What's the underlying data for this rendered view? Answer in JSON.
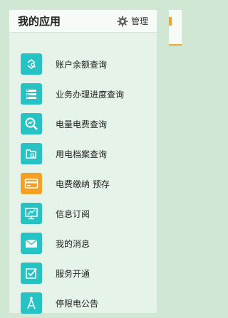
{
  "panel": {
    "title": "我的应用",
    "manage_label": "管理",
    "manage_icon": "gear-icon"
  },
  "menu": {
    "items": [
      {
        "label": "账户余额查询",
        "icon": "account-balance-icon",
        "color": "#27c2c4"
      },
      {
        "label": "业务办理进度查询",
        "icon": "progress-list-icon",
        "color": "#27c2c4"
      },
      {
        "label": "电量电费查询",
        "icon": "magnifier-chart-icon",
        "color": "#27c2c4"
      },
      {
        "label": "用电档案查询",
        "icon": "folder-search-icon",
        "color": "#27c2c4"
      },
      {
        "label": "电费缴纳 预存",
        "icon": "card-icon",
        "color": "#f4a024"
      },
      {
        "label": "信息订阅",
        "icon": "monitor-subscribe-icon",
        "color": "#27c2c4"
      },
      {
        "label": "我的消息",
        "icon": "mail-icon",
        "color": "#27c2c4"
      },
      {
        "label": "服务开通",
        "icon": "checkbox-icon",
        "color": "#27c2c4"
      },
      {
        "label": "停限电公告",
        "icon": "compass-icon",
        "color": "#27c2c4"
      }
    ]
  }
}
